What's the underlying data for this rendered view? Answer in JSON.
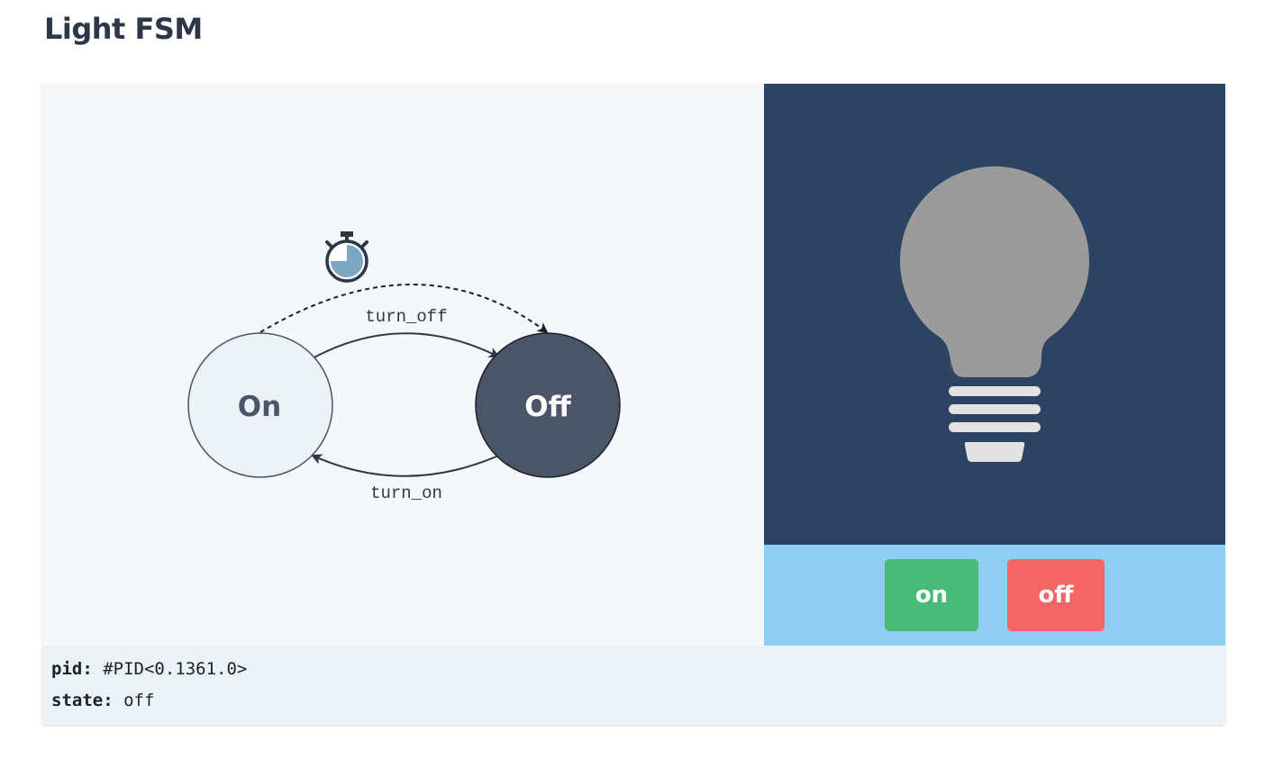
{
  "title": "Light FSM",
  "diagram": {
    "states": [
      {
        "id": "on",
        "label": "On",
        "active": false
      },
      {
        "id": "off",
        "label": "Off",
        "active": true
      }
    ],
    "transitions": [
      {
        "from": "on",
        "to": "off",
        "label": "turn_off"
      },
      {
        "from": "off",
        "to": "on",
        "label": "turn_on"
      }
    ],
    "timer_transition": {
      "from": "on",
      "to": "off",
      "icon": "stopwatch-icon"
    }
  },
  "bulb": {
    "lit": false,
    "icon": "lightbulb-icon"
  },
  "controls": {
    "on_label": "on",
    "off_label": "off"
  },
  "info": {
    "pid_key": "pid:",
    "pid_value": "#PID<0.1361.0>",
    "state_key": "state:",
    "state_value": "off"
  },
  "colors": {
    "inactive_state": "#edf2f7",
    "active_state": "#4a5568",
    "bulb_panel": "#2c4364",
    "bulb_off": "#9b9b9b",
    "controls_panel": "#90cdf4",
    "on_button": "#48bb78",
    "off_button": "#f56565"
  }
}
